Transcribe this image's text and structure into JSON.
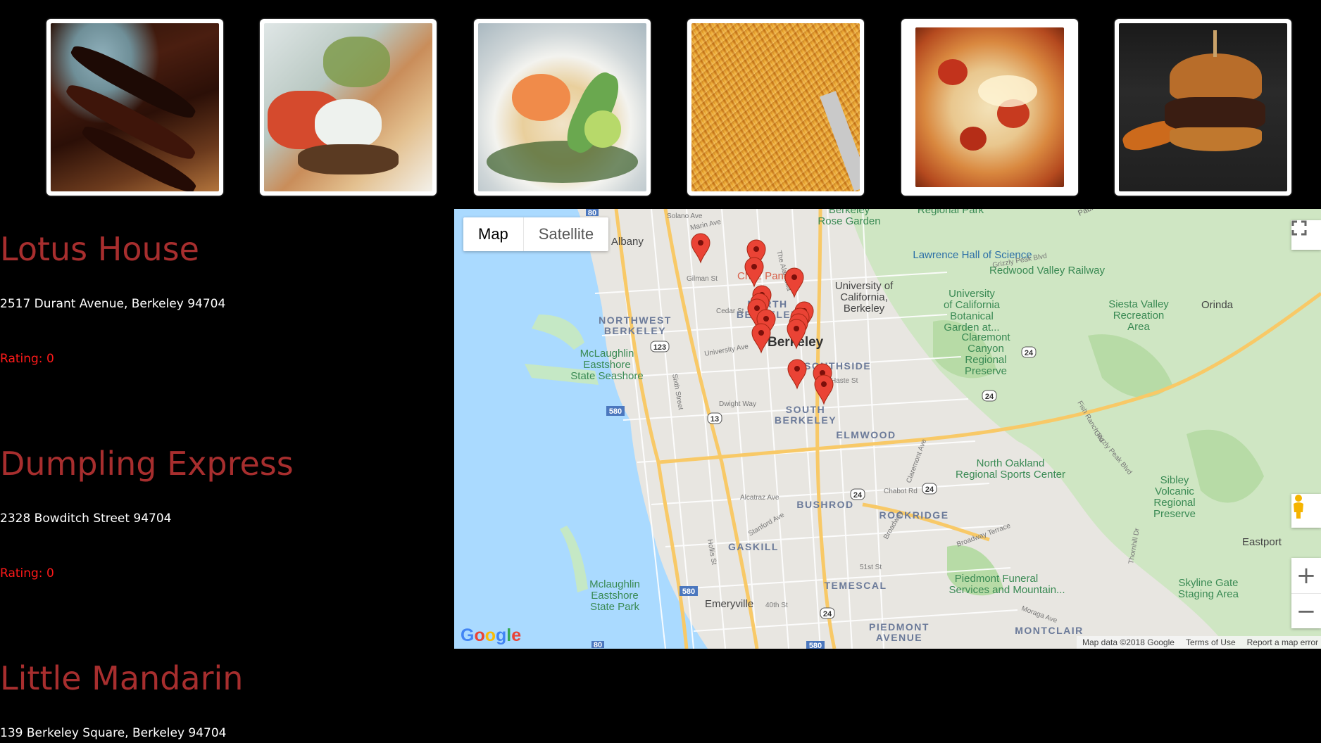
{
  "thumbnails": [
    {
      "alt": "ribs"
    },
    {
      "alt": "gyro"
    },
    {
      "alt": "pad-thai"
    },
    {
      "alt": "noodles"
    },
    {
      "alt": "pizza"
    },
    {
      "alt": "burger"
    }
  ],
  "restaurants": [
    {
      "name": "Lotus House",
      "address": "2517 Durant Avenue, Berkeley 94704",
      "rating": "Rating: 0"
    },
    {
      "name": "Dumpling Express",
      "address": "2328 Bowditch Street 94704",
      "rating": "Rating: 0"
    },
    {
      "name": "Little Mandarin",
      "address": "139 Berkeley Square, Berkeley 94704"
    }
  ],
  "map": {
    "type_buttons": {
      "map": "Map",
      "satellite": "Satellite"
    },
    "footer": {
      "data": "Map data ©2018 Google",
      "terms": "Terms of Use",
      "report": "Report a map error"
    },
    "logo_letters": [
      "G",
      "o",
      "o",
      "g",
      "l",
      "e"
    ],
    "labels": {
      "albany": "Albany",
      "berkeley": "Berkeley",
      "northwest_berkeley": "NORTHWEST",
      "northwest_berkeley_2": "BERKELEY",
      "north_berkeley": "NORTH",
      "north_berkeley_2": "BERKELEY",
      "south_berkeley": "SOUTH",
      "south_berkeley_2": "BERKELEY",
      "southside": "SOUTHSIDE",
      "elmwood": "ELMWOOD",
      "bushrod": "BUSHROD",
      "rockridge": "ROCKRIDGE",
      "gaskill": "GASKILL",
      "temescal": "TEMESCAL",
      "piedmont_avenue": "PIEDMONT",
      "piedmont_avenue_2": "AVENUE",
      "montclair": "MONTCLAIR",
      "emeryville": "Emeryville",
      "orinda": "Orinda",
      "eastport": "Eastport",
      "piedmont": "Piedmont",
      "rose_garden": "Berkeley",
      "rose_garden_2": "Rose Garden",
      "regional_park": "Regional Park",
      "lawrence": "Lawrence Hall of Science",
      "redwood": "Redwood Valley Railway",
      "uc_berkeley_1": "University of",
      "uc_berkeley_2": "California,",
      "uc_berkeley_3": "Berkeley",
      "botanical_1": "University",
      "botanical_2": "of California",
      "botanical_3": "Botanical",
      "botanical_4": "Garden at...",
      "siesta_1": "Siesta Valley",
      "siesta_2": "Recreation",
      "siesta_3": "Area",
      "claremont_1": "Claremont",
      "claremont_2": "Canyon",
      "claremont_3": "Regional",
      "claremont_4": "Preserve",
      "mclaughlin_1": "McLaughlin",
      "mclaughlin_2": "Eastshore",
      "mclaughlin_3": "State Seashore",
      "mclaughlin2_1": "Mclaughlin",
      "mclaughlin2_2": "Eastshore",
      "mclaughlin2_3": "State Park",
      "north_oakland_1": "North Oakland",
      "north_oakland_2": "Regional Sports Center",
      "sibley_1": "Sibley",
      "sibley_2": "Volcanic",
      "sibley_3": "Regional",
      "sibley_4": "Preserve",
      "piedmont_funeral_1": "Piedmont Funeral",
      "piedmont_funeral_2": "Services and Mountain...",
      "skyline_1": "Skyline Gate",
      "skyline_2": "Staging Area",
      "chez": "Chez Panisse",
      "pablo": "Pablo",
      "solano": "Solano Ave",
      "marin": "Marin Ave",
      "gilman": "Gilman St",
      "cedar": "Cedar St",
      "university": "University Ave",
      "haste": "Haste St",
      "dwight": "Dwight Way",
      "alcatraz": "Alcatraz Ave",
      "stanford": "Stanford Ave",
      "sixth": "Sixth Street",
      "hollis": "Hollis St",
      "chabot": "Chabot Rd",
      "broadway": "Broadway",
      "broadway_terrace": "Broadway Terrace",
      "fish_ranch": "Fish Ranch Rd",
      "grizzly": "Grizzly Peak Blvd",
      "grizzly2": "Grizzly Peak Blvd",
      "moraga": "Moraga Ave",
      "thornhill": "Thornhill Dr",
      "claremont_ave": "Claremont Ave",
      "st51": "51st St",
      "st40": "40th St",
      "alameda": "The Alameda",
      "r80": "80",
      "r80b": "80",
      "r123": "123",
      "r580": "580",
      "r580b": "580",
      "r580c": "580",
      "r13": "13",
      "r24a": "24",
      "r24b": "24",
      "r24c": "24",
      "r24d": "24",
      "r24e": "24"
    },
    "marker_count": 16
  }
}
